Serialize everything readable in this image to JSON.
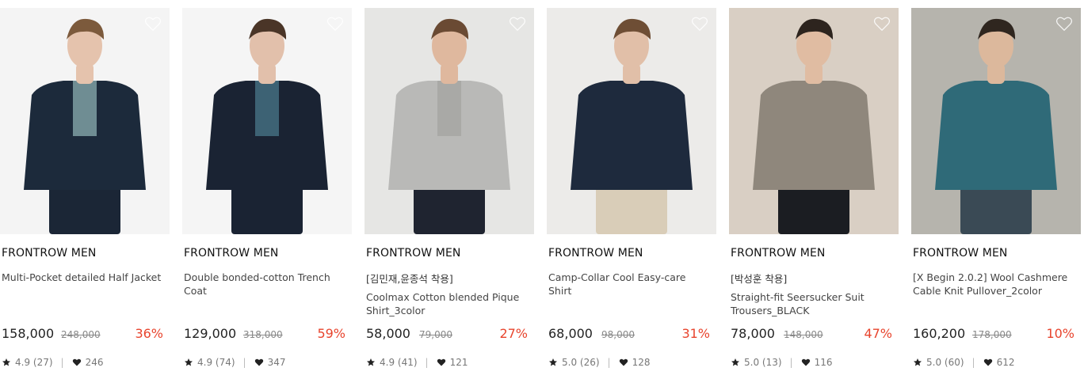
{
  "products": [
    {
      "brand": "FRONTROW MEN",
      "tag": "",
      "title": "Multi-Pocket detailed Half Jacket",
      "price": "158,000",
      "original_price": "248,000",
      "discount": "36%",
      "rating": "4.9 (27)",
      "likes": "246",
      "palette": {
        "bg": "#f4f4f4",
        "top": "#1c2a3b",
        "inner": "#6f8d93",
        "bottom": "#1b2636",
        "skin": "#e5c3ad",
        "hair": "#7c5a3c"
      }
    },
    {
      "brand": "FRONTROW MEN",
      "tag": "",
      "title": "Double bonded-cotton Trench Coat",
      "price": "129,000",
      "original_price": "318,000",
      "discount": "59%",
      "rating": "4.9 (74)",
      "likes": "347",
      "palette": {
        "bg": "#f5f5f5",
        "top": "#1a2333",
        "inner": "#3d6274",
        "bottom": "#1a2333",
        "skin": "#e2c0ab",
        "hair": "#4a3527"
      }
    },
    {
      "brand": "FRONTROW MEN",
      "tag": "[김민재,윤종석 착용]",
      "title": "Coolmax Cotton blended Pique Shirt_3color",
      "price": "58,000",
      "original_price": "79,000",
      "discount": "27%",
      "rating": "4.9 (41)",
      "likes": "121",
      "palette": {
        "bg": "#e6e6e4",
        "top": "#b9b9b7",
        "inner": "#a9a9a6",
        "bottom": "#1f2430",
        "skin": "#dfb89e",
        "hair": "#6a4a33"
      }
    },
    {
      "brand": "FRONTROW MEN",
      "tag": "",
      "title": "Camp-Collar Cool Easy-care Shirt",
      "price": "68,000",
      "original_price": "98,000",
      "discount": "31%",
      "rating": "5.0 (26)",
      "likes": "128",
      "palette": {
        "bg": "#ecebe9",
        "top": "#1e2a3d",
        "inner": "#1e2a3d",
        "bottom": "#d9cdb8",
        "skin": "#e1bfa8",
        "hair": "#6e4e35"
      }
    },
    {
      "brand": "FRONTROW MEN",
      "tag": "[박성훈 착용]",
      "title": "Straight-fit Seersucker Suit Trousers_BLACK",
      "price": "78,000",
      "original_price": "148,000",
      "discount": "47%",
      "rating": "5.0 (13)",
      "likes": "116",
      "palette": {
        "bg": "#d9cfc4",
        "top": "#8f877c",
        "inner": "#8f877c",
        "bottom": "#1b1d22",
        "skin": "#e0bca2",
        "hair": "#2d241e"
      }
    },
    {
      "brand": "FRONTROW MEN",
      "tag": "",
      "title": "[X Begin 2.0.2] Wool Cashmere Cable Knit Pullover_2color",
      "price": "160,200",
      "original_price": "178,000",
      "discount": "10%",
      "rating": "5.0 (60)",
      "likes": "612",
      "palette": {
        "bg": "#b6b4ad",
        "top": "#2f6a78",
        "inner": "#2f6a78",
        "bottom": "#3a4a55",
        "skin": "#dcb89c",
        "hair": "#2f261f"
      }
    }
  ],
  "icons": {
    "wishlist": "heart-outline-icon",
    "rating": "star-icon",
    "likes": "heart-filled-icon"
  },
  "colors": {
    "discount": "#e8442d",
    "text": "#222222",
    "muted": "#777777"
  }
}
